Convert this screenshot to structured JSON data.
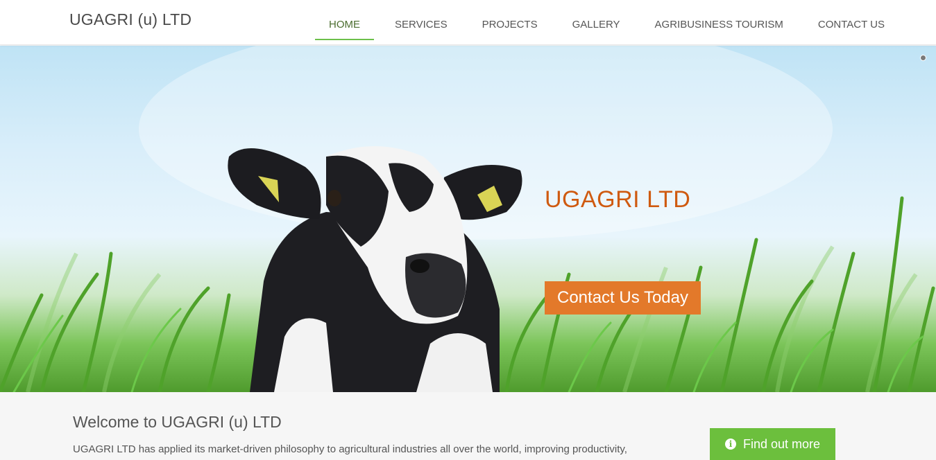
{
  "brand": {
    "name": "UGAGRI (u) LTD"
  },
  "nav": {
    "items": [
      {
        "label": "HOME",
        "active": true
      },
      {
        "label": "SERVICES",
        "active": false
      },
      {
        "label": "PROJECTS",
        "active": false
      },
      {
        "label": "GALLERY",
        "active": false
      },
      {
        "label": "AGRIBUSINESS TOURISM",
        "active": false
      },
      {
        "label": "CONTACT US",
        "active": false
      }
    ]
  },
  "hero": {
    "title": "UGAGRI LTD",
    "cta_label": "Contact Us Today",
    "slider_dots": 1
  },
  "welcome": {
    "title": "Welcome to UGAGRI (u) LTD",
    "text": "UGAGRI LTD has applied its market-driven philosophy to agricultural industries all over the world, improving productivity,",
    "button_label": "Find out more",
    "button_icon": "info-circle-icon"
  },
  "colors": {
    "accent_green": "#6cbf3d",
    "accent_orange": "#e3792a",
    "hero_title": "#cf5a10",
    "text": "#555555"
  }
}
